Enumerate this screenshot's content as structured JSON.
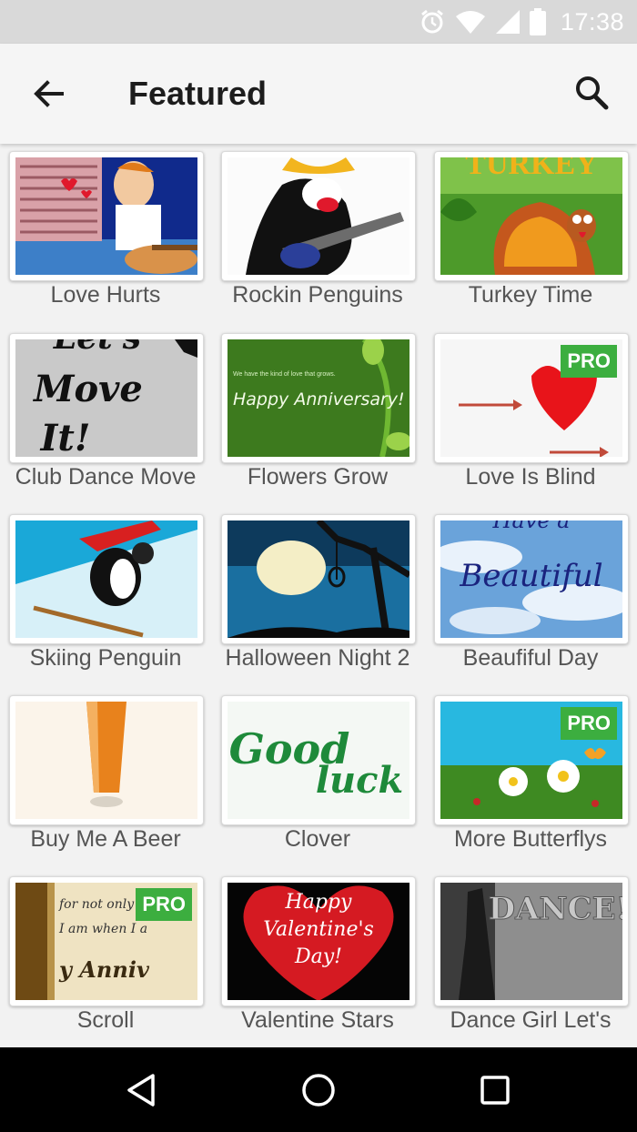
{
  "status_bar": {
    "time": "17:38"
  },
  "app_bar": {
    "title": "Featured"
  },
  "items": [
    {
      "label": "Love  Hurts",
      "pro": false
    },
    {
      "label": "Rockin Penguins",
      "pro": false
    },
    {
      "label": "Turkey Time",
      "pro": false
    },
    {
      "label": "Club Dance Move",
      "pro": false
    },
    {
      "label": "Flowers Grow",
      "pro": false
    },
    {
      "label": "Love Is Blind",
      "pro": true,
      "badge": "PRO"
    },
    {
      "label": "Skiing Penguin",
      "pro": false
    },
    {
      "label": "Halloween Night 2",
      "pro": false
    },
    {
      "label": "Beaufiful Day",
      "pro": false
    },
    {
      "label": "Buy Me A Beer",
      "pro": false
    },
    {
      "label": "Clover",
      "pro": false
    },
    {
      "label": "More Butterflys",
      "pro": true,
      "badge": "PRO"
    },
    {
      "label": "Scroll",
      "pro": true,
      "badge": "PRO"
    },
    {
      "label": "Valentine Stars",
      "pro": false
    },
    {
      "label": "Dance Girl Let's",
      "pro": false
    }
  ],
  "thumb_text": {
    "turkey": "TURKEY",
    "club_dance_1": "Let's",
    "club_dance_2": "Move",
    "club_dance_3": "It!",
    "flowers_small": "We have the kind of love that grows.",
    "flowers_main": "Happy Anniversary!",
    "beautiful_1": "Have a",
    "beautiful_2": "Beautiful",
    "good": "Good",
    "luck": "luck",
    "scroll_1": "for not only",
    "scroll_2": "I am when I a",
    "scroll_3": "y Anniv",
    "valentine_1": "Happy",
    "valentine_2": "Valentine's",
    "valentine_3": "Day!",
    "dance": "DANCE!"
  }
}
